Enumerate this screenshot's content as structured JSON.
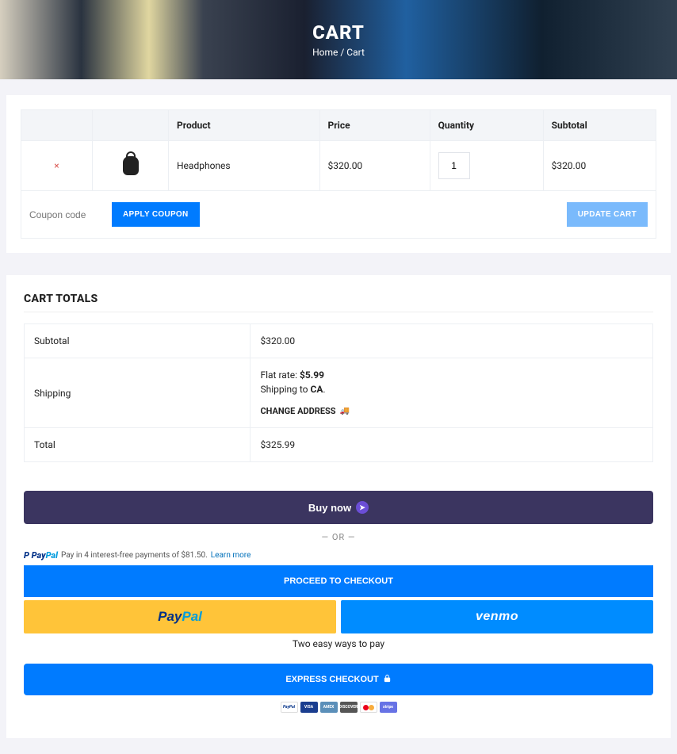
{
  "hero": {
    "title": "CART",
    "breadcrumb": {
      "home": "Home",
      "sep": "/",
      "current": "Cart"
    }
  },
  "cart_table": {
    "headers": {
      "product": "Product",
      "price": "Price",
      "quantity": "Quantity",
      "subtotal": "Subtotal"
    },
    "item": {
      "remove_icon": "×",
      "name": "Headphones",
      "price": "$320.00",
      "qty": "1",
      "subtotal": "$320.00"
    },
    "coupon": {
      "placeholder": "Coupon code",
      "apply_label": "APPLY COUPON",
      "update_label": "UPDATE CART"
    }
  },
  "totals": {
    "title": "CART TOTALS",
    "rows": {
      "subtotal_label": "Subtotal",
      "subtotal_value": "$320.00",
      "shipping_label": "Shipping",
      "flat_rate_prefix": "Flat rate: ",
      "flat_rate_value": "$5.99",
      "shipping_to_prefix": "Shipping to ",
      "shipping_to_value": "CA",
      "shipping_to_suffix": ".",
      "change_address": "CHANGE ADDRESS",
      "total_label": "Total",
      "total_value": "$325.99"
    }
  },
  "checkout": {
    "buy_now": "Buy now",
    "or": "— OR —",
    "paypal_msg": "Pay in 4 interest-free payments of $81.50.",
    "learn_more": "Learn more",
    "proceed": "PROCEED TO CHECKOUT",
    "venmo": "venmo",
    "two_ways": "Two easy ways to pay",
    "express": "EXPRESS CHECKOUT",
    "pm": {
      "visa": "VISA",
      "disc": "DISCOVER",
      "stripe": "stripe",
      "amex": "AMEX"
    }
  }
}
